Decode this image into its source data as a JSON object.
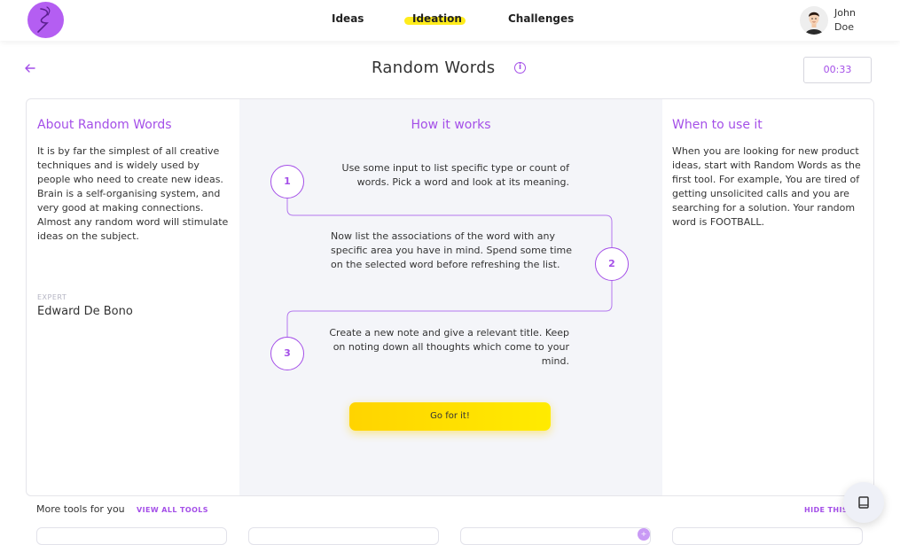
{
  "nav": {
    "items": [
      {
        "label": "Ideas"
      },
      {
        "label": "Ideation"
      },
      {
        "label": "Challenges"
      }
    ],
    "active": "Ideation"
  },
  "user": {
    "name_first": "John",
    "name_last": "Doe"
  },
  "page": {
    "title": "Random Words",
    "timer": "00:33"
  },
  "about": {
    "title": "About Random Words",
    "text": "It is by far the simplest of all creative techniques and is widely used by people who need to create new ideas. Brain is a self-organising system, and very good at making connections. Almost any random word will stimulate ideas on the subject.",
    "expert_label": "EXPERT",
    "expert_name": "Edward De Bono"
  },
  "how": {
    "title": "How it works",
    "steps": [
      {
        "number": "1",
        "text": "Use some input to list specific type or count of words. Pick a word and look at its meaning."
      },
      {
        "number": "2",
        "text": "Now list the associations of the word with any specific area you have in mind. Spend some time on the selected word before refreshing the list."
      },
      {
        "number": "3",
        "text": "Create a new note and give a relevant title. Keep on noting down all thoughts which come to your mind."
      }
    ],
    "cta": "Go for it!"
  },
  "when": {
    "title": "When to use it",
    "text": "When you are looking for new product ideas, start with Random Words as the first tool. For example, You are tired of getting unsolicited calls and you are searching for a solution. Your random word is FOOTBALL."
  },
  "bottom": {
    "more_tools": "More tools for you",
    "view_all": "VIEW ALL TOOLS",
    "hide": "HIDE THIS"
  },
  "colors": {
    "accent": "#a44fe8",
    "highlight": "#ffec1c",
    "button": "#ffe100",
    "panel": "#f4f5f9"
  },
  "icons": {
    "logo": "brand-logo",
    "back": "arrow-left-icon",
    "info": "info-icon",
    "fab": "book-icon"
  }
}
